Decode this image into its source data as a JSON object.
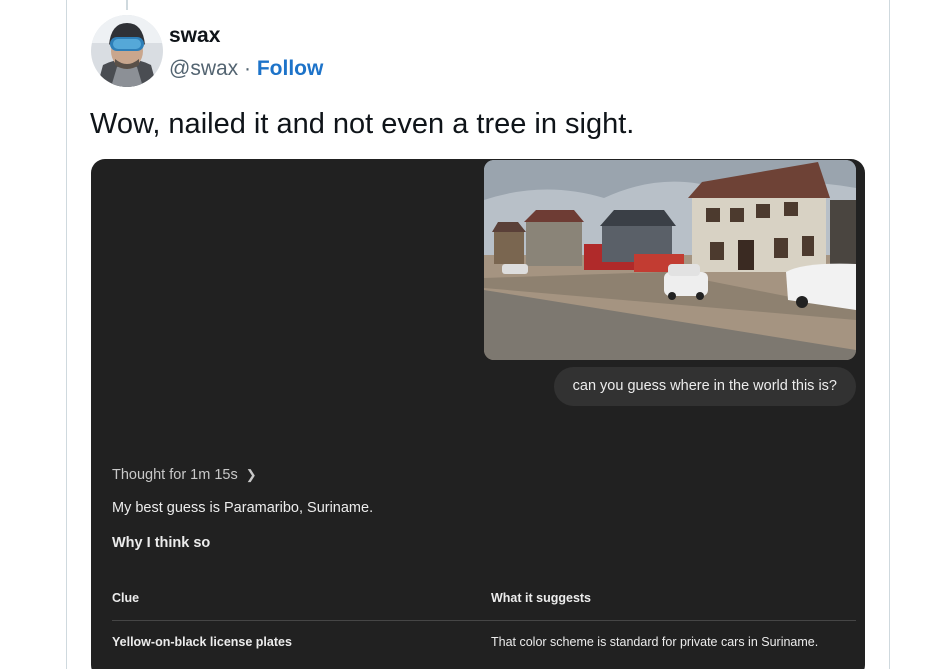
{
  "author": {
    "name": "swax",
    "handle": "@swax",
    "separator": "·",
    "follow_label": "Follow"
  },
  "tweet": {
    "text": "Wow, nailed it and not even a tree in sight."
  },
  "chat": {
    "user_message": "can you guess where in the world this is?",
    "thought_label": "Thought for 1m 15s",
    "answer": "My best guess is Paramaribo, Suriname.",
    "section_heading": "Why I think so",
    "table": {
      "headers": [
        "Clue",
        "What it suggests"
      ],
      "rows": [
        [
          "Yellow-on-black license plates",
          "That color scheme is standard for private cars in Suriname."
        ]
      ]
    }
  },
  "colors": {
    "follow": "#1d73c9",
    "panel": "#212121",
    "bubble": "#323232"
  }
}
